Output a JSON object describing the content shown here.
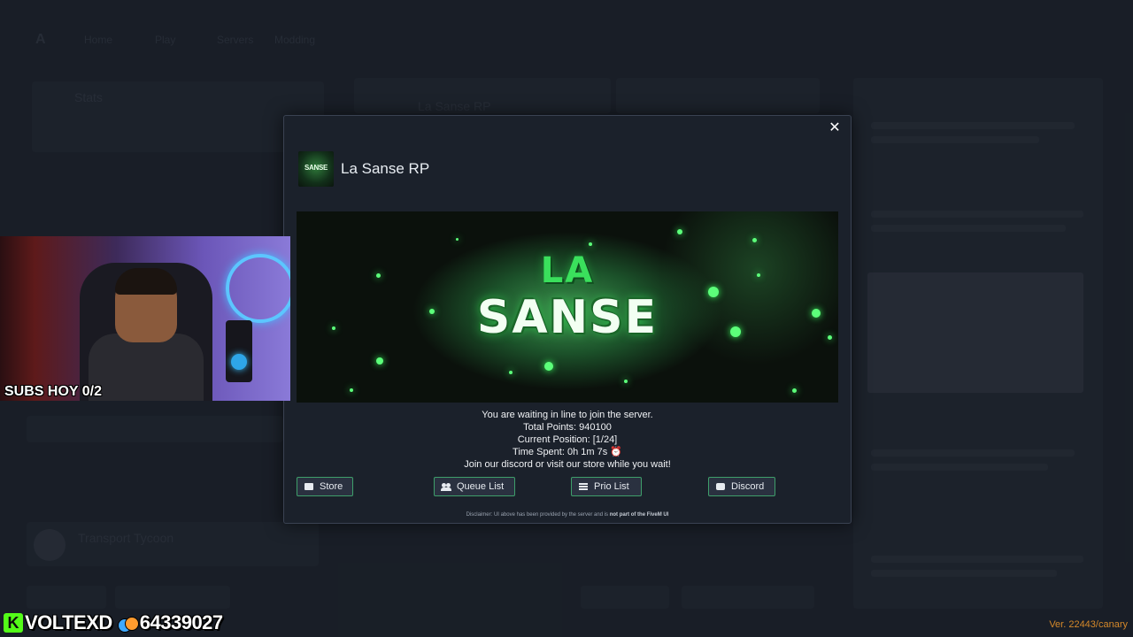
{
  "modal": {
    "close_symbol": "✕",
    "server_logo_text": "SANSE",
    "server_name": "La Sanse RP",
    "banner": {
      "line1": "LA",
      "line2": "SANSE"
    },
    "queue_info": {
      "waiting": "You are waiting in line to join the server.",
      "total_points": "Total Points: 940100",
      "current_position": "Current Position: [1/24]",
      "time_spent": "Time Spent: 0h 1m 7s ⏰",
      "promo": "Join our discord or visit our store while you wait!"
    },
    "buttons": {
      "store": "Store",
      "queue_list": "Queue List",
      "prio_list": "Prio List",
      "discord": "Discord"
    },
    "disclaimer_prefix": "Disclaimer: UI above has been provided by the server and is ",
    "disclaimer_bold": "not part of the FiveM UI"
  },
  "stream_overlay": {
    "subs_text": "SUBS HOY 0/2",
    "kick_badge": "K",
    "kick_username": "VOLTEXD",
    "coin_count": "64339027",
    "coin_icon": "coins-icon"
  },
  "background": {
    "nav_logo": "A",
    "nav_items": [
      "Home",
      "Play",
      "Servers",
      "Modding"
    ],
    "left_card_title": "Stats",
    "left_list_title": "Transport Tycoon",
    "middle_title": "La Sanse RP"
  },
  "version": "Ver. 22443/canary",
  "colors": {
    "accent_button_border": "#3e9e6a",
    "version_text": "#d4882a",
    "kick_green": "#53fc18"
  }
}
